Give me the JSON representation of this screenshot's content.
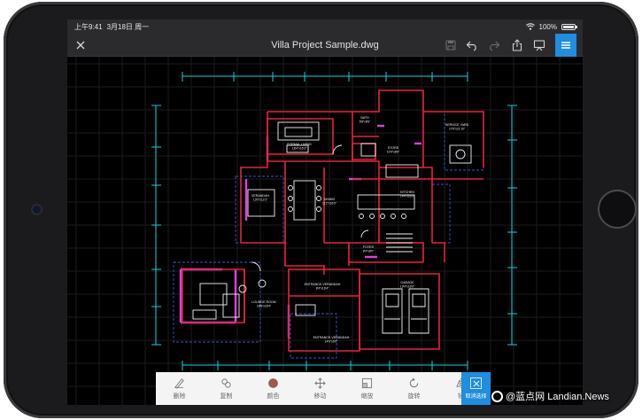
{
  "status_bar": {
    "time": "上午9:41",
    "date": "3月18日 周一",
    "battery_text": "100%",
    "battery_level": 1.0
  },
  "toolbar": {
    "title": "Villa Project Sample.dwg",
    "icons": [
      "close-icon",
      "save-icon",
      "undo-icon",
      "redo-icon",
      "share-icon",
      "present-icon",
      "menu-icon"
    ]
  },
  "edit_bar": {
    "items": [
      {
        "icon": "pencil-icon",
        "label": "删除"
      },
      {
        "icon": "copy-icon",
        "label": "复制"
      },
      {
        "icon": "color-icon",
        "label": "颜色"
      },
      {
        "icon": "move-icon",
        "label": "移动"
      },
      {
        "icon": "scale-icon",
        "label": "缩放"
      },
      {
        "icon": "rotate-icon",
        "label": "旋转"
      },
      {
        "icon": "mirror-icon",
        "label": "镜"
      }
    ],
    "deselect_label": "取消选择"
  },
  "drawing": {
    "rooms": [
      {
        "name": "BATH",
        "size": "5'8\"x8'9\""
      },
      {
        "name": "SERVICE YARD",
        "size": "17'6\"x21'10\""
      },
      {
        "name": "FORMAL LIVING",
        "size": "18'4\"x16'2\""
      },
      {
        "name": "STORE",
        "size": "10'4\"x8'6\""
      },
      {
        "name": "VERANDAH",
        "size": "13'0\"x12'2\""
      },
      {
        "name": "DINING",
        "size": "11'2\"x16'0\""
      },
      {
        "name": "KITCHEN",
        "size": "14'4\"x16'0\""
      },
      {
        "name": "FOYER",
        "size": "8'4\"x8'0\""
      },
      {
        "name": "LOUNGE ROOM",
        "size": "18'8\"x16'4\""
      },
      {
        "name": "ENTRANCE VERANDAH",
        "size": "8'4\"x16'4\""
      },
      {
        "name": "GARAGE",
        "size": "19'4\"x16'0\""
      },
      {
        "name": "ENTRANCE VERANDAH",
        "size": "14'0\"x6'0\""
      }
    ],
    "colors": {
      "walls": "#e5243b",
      "furniture": "#f2f2f2",
      "selected": "#e03ce0",
      "dimensions": "#14d2dc",
      "grid": "#1b1b1b"
    }
  },
  "watermark": {
    "text": "@蓝点网 Landian.News"
  }
}
